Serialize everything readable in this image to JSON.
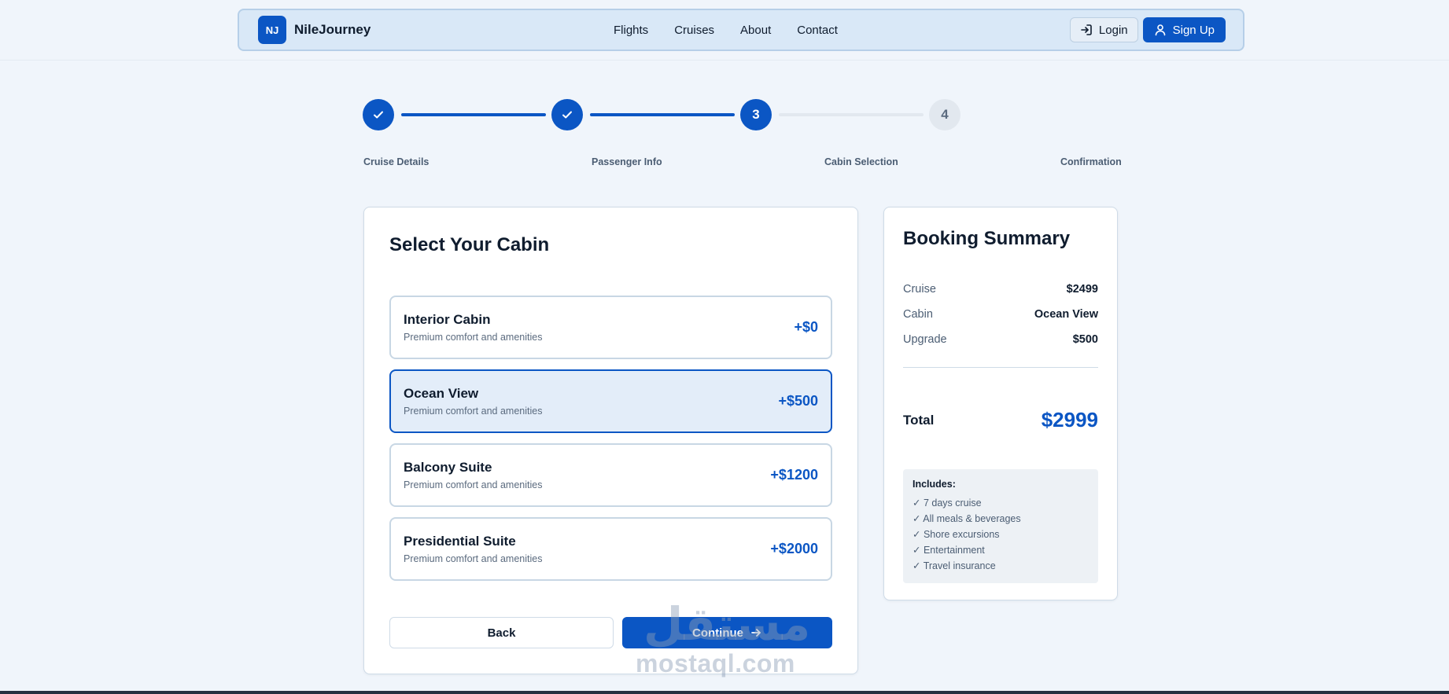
{
  "header": {
    "logo_initials": "NJ",
    "brand": "NileJourney",
    "nav_links": [
      "Flights",
      "Cruises",
      "About",
      "Contact"
    ],
    "login_label": "Login",
    "signup_label": "Sign Up"
  },
  "stepper": {
    "steps": [
      {
        "number": "1",
        "label": "Cruise Details",
        "status": "completed"
      },
      {
        "number": "2",
        "label": "Passenger Info",
        "status": "completed"
      },
      {
        "number": "3",
        "label": "Cabin Selection",
        "status": "active"
      },
      {
        "number": "4",
        "label": "Confirmation",
        "status": "pending"
      }
    ]
  },
  "cabin": {
    "title": "Select Your Cabin",
    "options": [
      {
        "name": "Interior Cabin",
        "desc": "Premium comfort and amenities",
        "price": "+$0",
        "selected": false
      },
      {
        "name": "Ocean View",
        "desc": "Premium comfort and amenities",
        "price": "+$500",
        "selected": true
      },
      {
        "name": "Balcony Suite",
        "desc": "Premium comfort and amenities",
        "price": "+$1200",
        "selected": false
      },
      {
        "name": "Presidential Suite",
        "desc": "Premium comfort and amenities",
        "price": "+$2000",
        "selected": false
      }
    ],
    "back_label": "Back",
    "continue_label": "Continue"
  },
  "summary": {
    "title": "Booking Summary",
    "rows": [
      {
        "label": "Cruise",
        "value": "$2499"
      },
      {
        "label": "Cabin",
        "value": "Ocean View"
      },
      {
        "label": "Upgrade",
        "value": "$500"
      }
    ],
    "total_label": "Total",
    "total_value": "$2999",
    "includes_title": "Includes:",
    "includes": [
      "✓ 7 days cruise",
      "✓ All meals & beverages",
      "✓ Shore excursions",
      "✓ Entertainment",
      "✓ Travel insurance"
    ]
  },
  "watermark": {
    "arabic": "مستقل",
    "latin": "mostaql.com"
  },
  "colors": {
    "accent": "#0b56c4",
    "background": "#f0f5fb",
    "pending": "#e2e8ef"
  },
  "icons": {
    "check": "check-icon",
    "login": "login-icon",
    "user": "user-icon",
    "arrow": "arrow-right-icon"
  }
}
